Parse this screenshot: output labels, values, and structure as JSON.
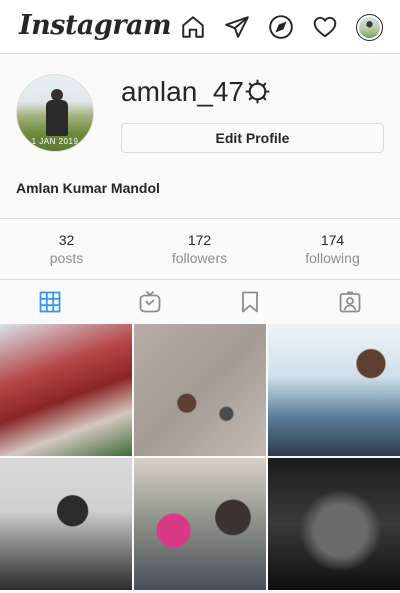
{
  "app": {
    "logo_text": "Instagram"
  },
  "topbar": {
    "icons": [
      "home-icon",
      "direct-icon",
      "explore-icon",
      "heart-icon",
      "profile-avatar"
    ]
  },
  "profile": {
    "username": "amlan_47",
    "edit_profile_label": "Edit Profile",
    "full_name": "Amlan Kumar Mandol",
    "profile_pic_caption": "1 JAN 2019"
  },
  "stats": {
    "posts": {
      "count": "32",
      "label": "posts"
    },
    "followers": {
      "count": "172",
      "label": "followers"
    },
    "following": {
      "count": "174",
      "label": "following"
    }
  },
  "tabs": [
    {
      "name": "posts-grid",
      "icon": "grid-icon",
      "active": true
    },
    {
      "name": "igtv",
      "icon": "igtv-icon",
      "active": false
    },
    {
      "name": "saved",
      "icon": "bookmark-icon",
      "active": false
    },
    {
      "name": "tagged",
      "icon": "tagged-icon",
      "active": false
    }
  ],
  "colors": {
    "active_tab": "#3897f0",
    "text": "#262626",
    "muted": "#8e8e8e",
    "border": "#dbdbdb"
  }
}
